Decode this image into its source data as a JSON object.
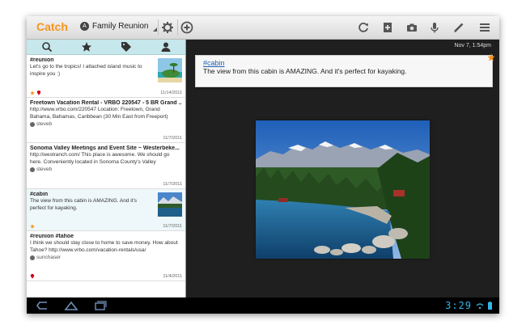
{
  "app": {
    "name": "Catch",
    "account": {
      "avatar_letter": "A",
      "name": "Family Reunion"
    }
  },
  "toolbar": {
    "icons": [
      "settings-icon",
      "add-icon",
      "sync-icon",
      "new-note-icon",
      "camera-icon",
      "voice-icon",
      "pen-icon",
      "menu-icon"
    ]
  },
  "filters": [
    "search-icon",
    "star-icon",
    "tag-icon",
    "person-icon"
  ],
  "notes": [
    {
      "title": "#reunion",
      "body": "Let's go to the tropics!  I attached island music to inspire you :)",
      "user": "",
      "date": "11/14/2011",
      "has_star": true,
      "has_location": true,
      "thumb": "island"
    },
    {
      "title": "Freetown Vacation Rental - VRBO 220547 - 5 BR Grand ...",
      "body": "http://www.vrbo.com/220547  Location: Freetown, Grand Bahama, Bahamas, Caribbean (30 Min East from Freeport)",
      "user": "steveb",
      "date": "11/7/2011",
      "has_star": false,
      "has_location": false,
      "thumb": ""
    },
    {
      "title": "Sonoma Valley Meetings and Event Site ~ Westerbeke...",
      "body": "http://westranch.com/  This place is awesome. We should go here.  Conveniently located in Sonoma County's Valley",
      "user": "steveb",
      "date": "11/7/2011",
      "has_star": false,
      "has_location": false,
      "thumb": ""
    },
    {
      "title": "#cabin",
      "body": "The view from this cabin is AMAZING. And it's perfect for kayaking.",
      "user": "",
      "date": "11/7/2011",
      "has_star": true,
      "has_location": false,
      "thumb": "lake"
    },
    {
      "title": "#reunion #tahoe",
      "body": "I think we should stay close to home to save money. How about Tahoe? http://www.vrbo.com/vacation-rentals/usa/",
      "user": "sunchaser",
      "date": "11/4/2011",
      "has_star": false,
      "has_location": true,
      "thumb": ""
    }
  ],
  "detail": {
    "timestamp": "Nov 7, 1:54pm",
    "tag": "#cabin",
    "text": "The view from this cabin is AMAZING. And it's perfect for kayaking.",
    "starred": true
  },
  "system": {
    "clock": "3:29",
    "nav": [
      "back-icon",
      "home-icon",
      "recent-apps-icon"
    ]
  },
  "colors": {
    "brand": "#f7941d",
    "filter_bar": "#c6e7eb",
    "clock": "#33b5e5",
    "link": "#1a5fb4",
    "star": "#f7941d",
    "location": "#d0021b"
  }
}
